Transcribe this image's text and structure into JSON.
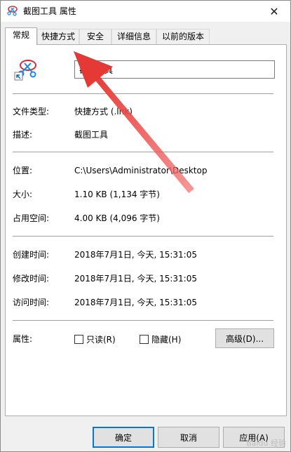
{
  "window": {
    "title": "截图工具 属性",
    "close_glyph": "✕"
  },
  "tabs": [
    {
      "label": "常规",
      "active": true
    },
    {
      "label": "快捷方式",
      "active": false
    },
    {
      "label": "安全",
      "active": false
    },
    {
      "label": "详细信息",
      "active": false
    },
    {
      "label": "以前的版本",
      "active": false
    }
  ],
  "general": {
    "file_name": "截图工具",
    "file_type_label": "文件类型:",
    "file_type_value": "快捷方式 (.lnk)",
    "description_label": "描述:",
    "description_value": "截图工具",
    "location_label": "位置:",
    "location_value": "C:\\Users\\Administrator\\Desktop",
    "size_label": "大小:",
    "size_value": "1.10 KB (1,134 字节)",
    "size_on_disk_label": "占用空间:",
    "size_on_disk_value": "4.00 KB (4,096 字节)",
    "created_label": "创建时间:",
    "created_value": "2018年7月1日, 今天, 15:31:05",
    "modified_label": "修改时间:",
    "modified_value": "2018年7月1日, 今天, 15:31:05",
    "accessed_label": "访问时间:",
    "accessed_value": "2018年7月1日, 今天, 15:31:05",
    "attributes_label": "属性:",
    "readonly_label": "只读(R)",
    "readonly_checked": false,
    "hidden_label": "隐藏(H)",
    "hidden_checked": false,
    "advanced_label": "高级(D)..."
  },
  "footer": {
    "ok_label": "确定",
    "cancel_label": "取消",
    "apply_label": "应用(A)"
  },
  "watermark": "Baidu 经验",
  "colors": {
    "arrow": "#e53935",
    "accent": "#0078d7"
  },
  "icons": {
    "app": "snipping-tool-icon",
    "shortcut_overlay": "shortcut-arrow-icon"
  }
}
